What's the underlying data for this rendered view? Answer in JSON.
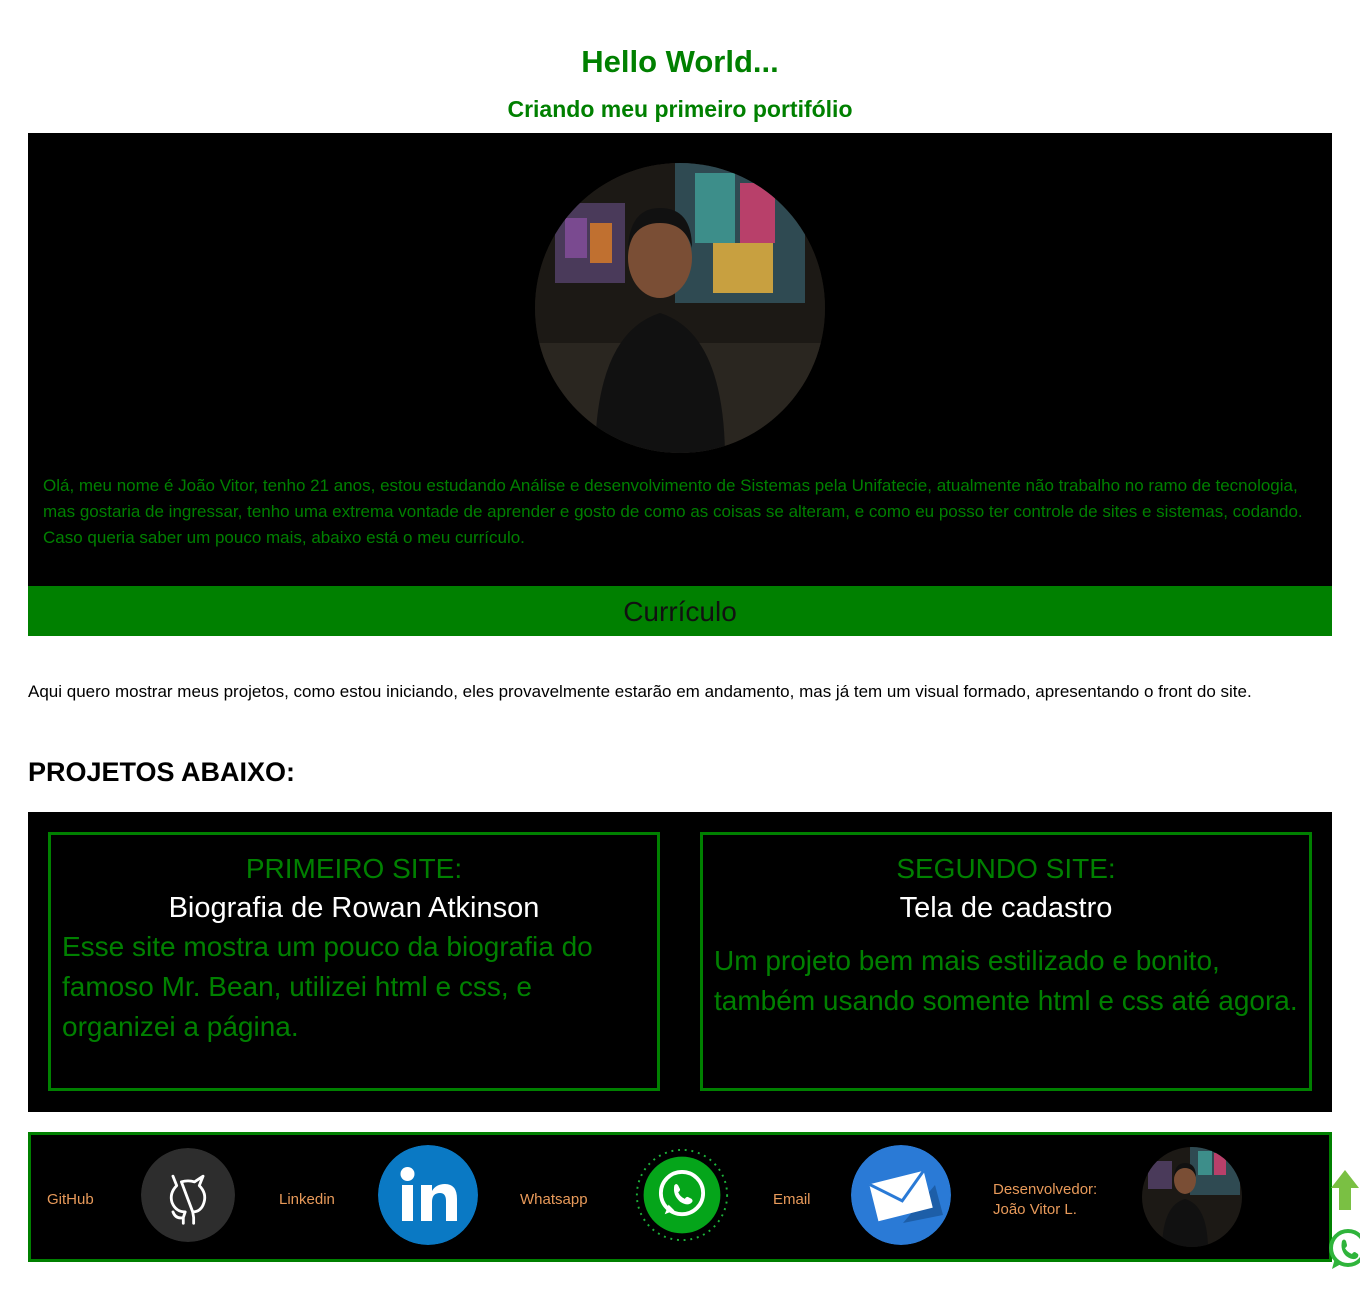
{
  "header": {
    "title": "Hello World...",
    "subtitle": "Criando meu primeiro portifólio"
  },
  "about": {
    "text": "Olá, meu nome é João Vitor, tenho 21 anos, estou estudando Análise e desenvolvimento de Sistemas pela Unifatecie, atualmente não trabalho no ramo de tecnologia, mas gostaria de ingressar, tenho uma extrema vontade de aprender e gosto de como as coisas se alteram, e como eu posso ter controle de sites e sistemas, codando. Caso queria saber um pouco mais, abaixo está o meu currículo.",
    "curriculo_label": "Currículo"
  },
  "intro": "Aqui quero mostrar meus projetos, como estou iniciando, eles provavelmente estarão em andamento, mas já tem um visual formado, apresentando o front do site.",
  "projects": {
    "heading": "PROJETOS ABAIXO:",
    "items": [
      {
        "label": "PRIMEIRO SITE:",
        "name": "Biografia de Rowan Atkinson",
        "description": "Esse site mostra um pouco da biografia do famoso Mr. Bean, utilizei html e css, e organizei a página."
      },
      {
        "label": "SEGUNDO SITE:",
        "name": "Tela de cadastro",
        "description": "Um projeto bem mais estilizado e bonito, também usando somente html e css até agora."
      }
    ]
  },
  "footer": {
    "github_label": "GitHub",
    "linkedin_label": "Linkedin",
    "whatsapp_label": "Whatsapp",
    "email_label": "Email",
    "developer_label": "Desenvolvedor:",
    "developer_name": "João Vitor L."
  },
  "icons": {
    "github": "github-icon",
    "linkedin": "linkedin-icon",
    "whatsapp": "whatsapp-icon",
    "email": "email-icon",
    "back_to_top": "arrow-up-icon",
    "floating_whatsapp": "whatsapp-icon"
  },
  "colors": {
    "accent": "#008000",
    "footer_text": "#e89a5a",
    "background_dark": "#000000"
  }
}
